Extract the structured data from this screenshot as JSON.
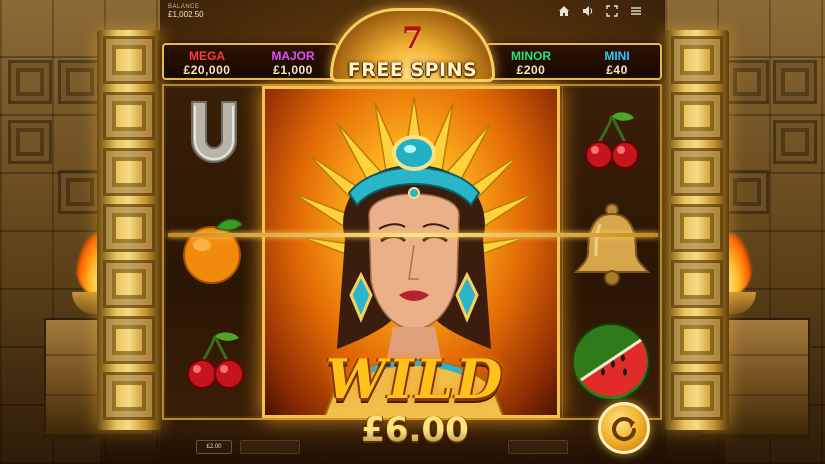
{
  "balance": {
    "label": "BALANCE",
    "value": "£1,002.50"
  },
  "top_controls": [
    {
      "name": "home-icon"
    },
    {
      "name": "sound-icon"
    },
    {
      "name": "fullscreen-icon"
    },
    {
      "name": "menu-icon"
    }
  ],
  "jackpots": {
    "mega": {
      "name": "MEGA",
      "value": "£20,000"
    },
    "major": {
      "name": "MAJOR",
      "value": "£1,000"
    },
    "minor": {
      "name": "MINOR",
      "value": "£200"
    },
    "mini": {
      "name": "MINI",
      "value": "£40"
    }
  },
  "free_spins": {
    "count": "7",
    "label": "FREE SPINS"
  },
  "reels": {
    "reel1": [
      "horseshoe",
      "orange",
      "cherries"
    ],
    "reel2_4": "wild-queen",
    "reel5": [
      "cherries",
      "bell",
      "watermelon"
    ]
  },
  "wild": {
    "label": "WILD",
    "win": "£6.00"
  },
  "bet": {
    "value": "£2.00"
  },
  "colors": {
    "mega": "#ff3b3b",
    "major": "#e44cff",
    "minor": "#29e27a",
    "mini": "#2fc6ff",
    "gold": "#f2c14e"
  }
}
